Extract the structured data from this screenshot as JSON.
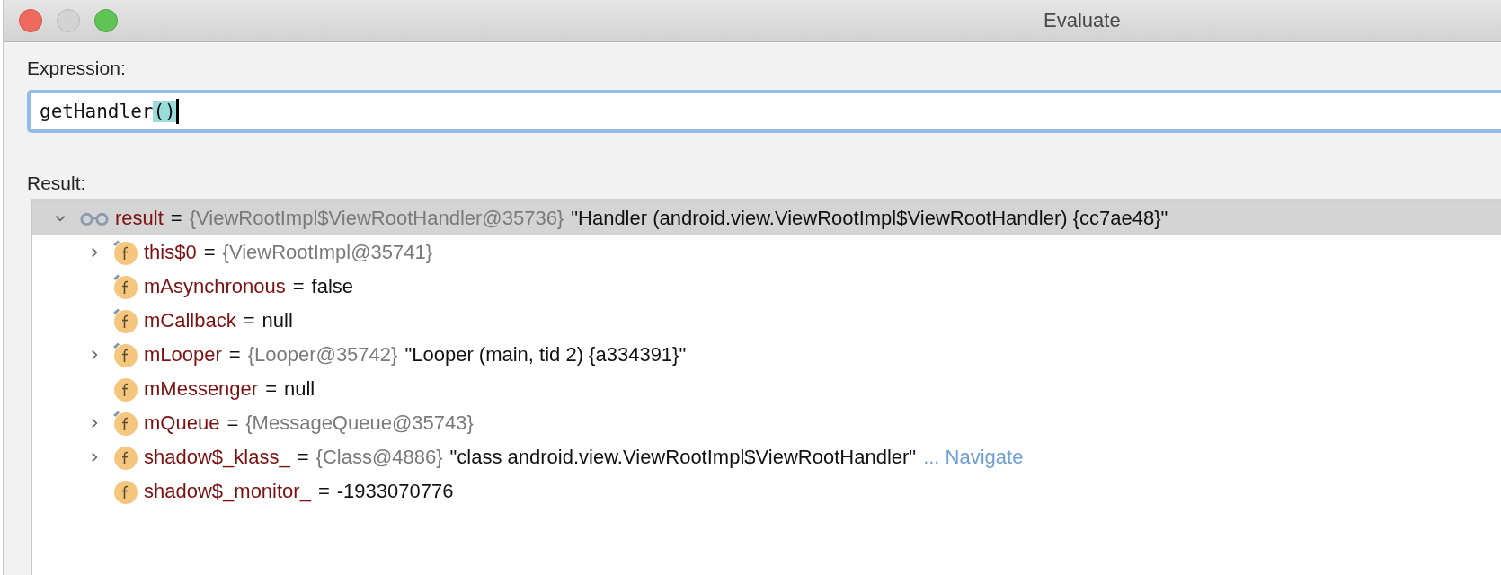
{
  "window": {
    "title": "Evaluate"
  },
  "expression": {
    "label": "Expression:",
    "value": "getHandler()",
    "brackets_highlighted": true
  },
  "result": {
    "label": "Result:",
    "tree": [
      {
        "kind": "watch",
        "expanded": true,
        "selected": true,
        "name": "result",
        "operator": "=",
        "type": "{ViewRootImpl$ViewRootHandler@35736}",
        "value": "\"Handler (android.view.ViewRootImpl$ViewRootHandler) {cc7ae48}\"",
        "children": [
          {
            "kind": "field",
            "pinned": true,
            "expanded": false,
            "selected": false,
            "name": "this$0",
            "operator": "=",
            "type": "{ViewRootImpl@35741}"
          },
          {
            "kind": "field",
            "pinned": true,
            "selected": false,
            "name": "mAsynchronous",
            "operator": "=",
            "value": "false"
          },
          {
            "kind": "field",
            "pinned": true,
            "selected": false,
            "name": "mCallback",
            "operator": "=",
            "value": "null"
          },
          {
            "kind": "field",
            "pinned": true,
            "expanded": false,
            "selected": false,
            "name": "mLooper",
            "operator": "=",
            "type": "{Looper@35742}",
            "value": "\"Looper (main, tid 2) {a334391}\""
          },
          {
            "kind": "field",
            "pinned": false,
            "selected": false,
            "name": "mMessenger",
            "operator": "=",
            "value": "null"
          },
          {
            "kind": "field",
            "pinned": true,
            "expanded": false,
            "selected": false,
            "name": "mQueue",
            "operator": "=",
            "type": "{MessageQueue@35743}"
          },
          {
            "kind": "field",
            "pinned": false,
            "expanded": false,
            "selected": false,
            "name": "shadow$_klass_",
            "operator": "=",
            "type": "{Class@4886}",
            "value": "\"class android.view.ViewRootImpl$ViewRootHandler\"",
            "link": "... Navigate"
          },
          {
            "kind": "field",
            "pinned": false,
            "selected": false,
            "name": "shadow$_monitor_",
            "operator": "=",
            "value": "-1933070776"
          }
        ]
      }
    ]
  }
}
